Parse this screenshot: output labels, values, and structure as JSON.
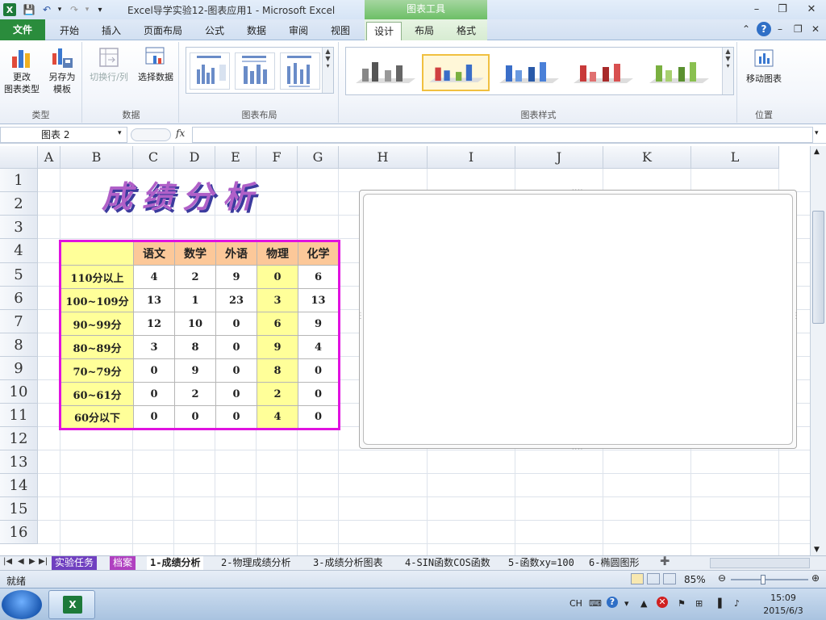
{
  "window": {
    "title": "Excel导学实验12-图表应用1  -  Microsoft Excel",
    "context_tab_header": "图表工具"
  },
  "ribbon_tabs": {
    "file": "文件",
    "tabs": [
      "开始",
      "插入",
      "页面布局",
      "公式",
      "数据",
      "审阅",
      "视图",
      "设计",
      "布局",
      "格式"
    ]
  },
  "ribbon": {
    "type_group": {
      "label": "类型",
      "change_chart_type": "更改\n图表类型",
      "save_template": "另存为\n模板"
    },
    "data_group": {
      "label": "数据",
      "switch_row_col": "切换行/列",
      "select_data": "选择数据"
    },
    "layout_group": {
      "label": "图表布局"
    },
    "styles_group": {
      "label": "图表样式"
    },
    "location_group": {
      "label": "位置",
      "move_chart": "移动图表"
    }
  },
  "formula_bar": {
    "name_box": "图表 2",
    "fx": "fx",
    "formula": ""
  },
  "grid": {
    "columns": [
      "A",
      "B",
      "C",
      "D",
      "E",
      "F",
      "G",
      "H",
      "I",
      "J",
      "K",
      "L"
    ],
    "rows": [
      "1",
      "2",
      "3",
      "4",
      "5",
      "6",
      "7",
      "8",
      "9",
      "10",
      "11",
      "12",
      "13",
      "14",
      "15",
      "16"
    ]
  },
  "sheet_title": "成绩分析",
  "score_table": {
    "headers": [
      "语文",
      "数学",
      "外语",
      "物理",
      "化学"
    ],
    "rows": [
      {
        "label": "110分以上",
        "values": [
          "4",
          "2",
          "9",
          "0",
          "6"
        ]
      },
      {
        "label": "100~109分",
        "values": [
          "13",
          "1",
          "23",
          "3",
          "13"
        ]
      },
      {
        "label": "90~99分",
        "values": [
          "12",
          "10",
          "0",
          "6",
          "9"
        ]
      },
      {
        "label": "80~89分",
        "values": [
          "3",
          "8",
          "0",
          "9",
          "4"
        ]
      },
      {
        "label": "70~79分",
        "values": [
          "0",
          "9",
          "0",
          "8",
          "0"
        ]
      },
      {
        "label": "60~61分",
        "values": [
          "0",
          "2",
          "0",
          "2",
          "0"
        ]
      },
      {
        "label": "60分以下",
        "values": [
          "0",
          "0",
          "0",
          "4",
          "0"
        ]
      }
    ]
  },
  "sheet_tabs": [
    "实验任务",
    "档案",
    "1-成绩分析",
    "2-物理成绩分析",
    "3-成绩分析图表",
    "4-SIN函数COS函数",
    "5-函数xy=100",
    "6-椭圆图形"
  ],
  "status": {
    "ready": "就绪",
    "zoom": "85%"
  },
  "taskbar": {
    "lang": "CH",
    "time": "15:09",
    "date": "2015/6/3"
  },
  "colors": {
    "file_tab": "#2a8c3c",
    "table_border": "#e012e0",
    "header_fill": "#fcc899",
    "label_fill": "#ffff99",
    "title_color": "#b060c8"
  }
}
